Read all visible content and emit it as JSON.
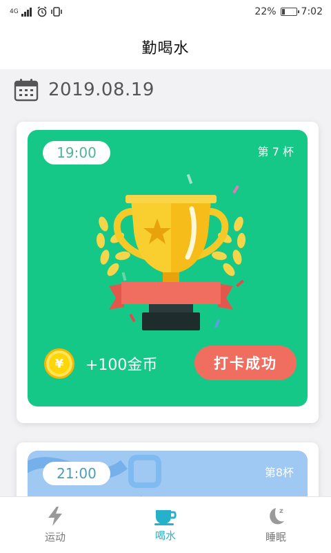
{
  "status_bar": {
    "network": "4G",
    "battery_percent": "22%",
    "battery_level": 0.22,
    "time": "7:02"
  },
  "header": {
    "title": "勤喝水"
  },
  "date": {
    "text": "2019.08.19",
    "icon": "calendar-icon"
  },
  "cards": [
    {
      "time": "19:00",
      "cup_label": "第 7 杯",
      "reward_text": "+100金币",
      "coin_symbol": "¥",
      "button_label": "打卡成功",
      "bg_color": "#15c888",
      "button_color": "#f06e5f"
    },
    {
      "time": "21:00",
      "cup_label": "第8杯",
      "bg_color": "#9fc8f2"
    }
  ],
  "tabs": [
    {
      "label": "运动",
      "icon": "lightning-icon",
      "active": false
    },
    {
      "label": "喝水",
      "icon": "cup-icon",
      "active": true
    },
    {
      "label": "睡眠",
      "icon": "moon-icon",
      "active": false
    }
  ],
  "colors": {
    "accent": "#25b1c9",
    "inactive": "#7a7a7a"
  }
}
